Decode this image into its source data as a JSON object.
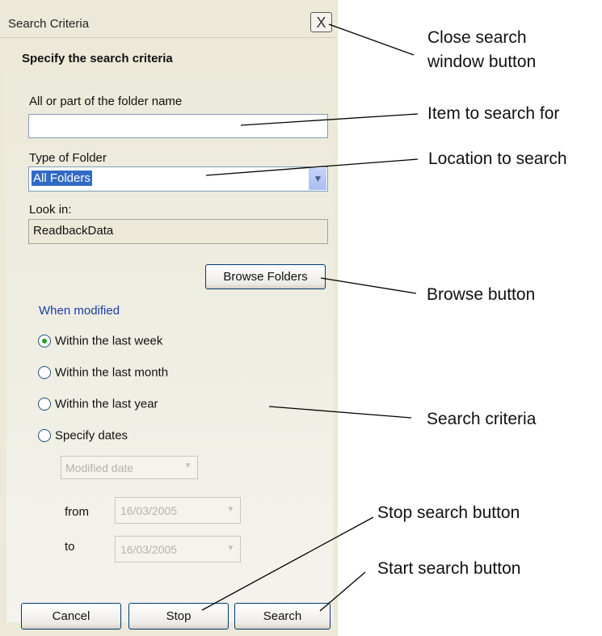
{
  "window": {
    "title": "Search Criteria",
    "close_glyph": "X",
    "subtitle": "Specify the search criteria"
  },
  "folder_name": {
    "label": "All or part of the folder name",
    "value": ""
  },
  "folder_type": {
    "label": "Type of Folder",
    "value": "All Folders"
  },
  "look_in": {
    "label": "Look in:",
    "value": "ReadbackData"
  },
  "browse_button": "Browse Folders",
  "when_modified": {
    "label": "When modified",
    "options": [
      {
        "label": "Within the last week",
        "checked": true
      },
      {
        "label": "Within the last month",
        "checked": false
      },
      {
        "label": "Within the last year",
        "checked": false
      },
      {
        "label": "Specify dates",
        "checked": false
      }
    ],
    "date_type": "Modified date",
    "from_label": "from",
    "from_value": "16/03/2005",
    "to_label": "to",
    "to_value": "16/03/2005"
  },
  "buttons": {
    "cancel": "Cancel",
    "stop": "Stop",
    "search": "Search"
  },
  "annotations": {
    "close_line1": "Close search",
    "close_line2": "window button",
    "item": "Item to search for",
    "location": "Location to search",
    "browse": "Browse button",
    "criteria": "Search criteria",
    "stop": "Stop search button",
    "start": "Start search button"
  },
  "colors": {
    "panel": "#ece9d8",
    "selection": "#316ac5",
    "group_label": "#1d3ca8",
    "radio_dot": "#21a121"
  }
}
